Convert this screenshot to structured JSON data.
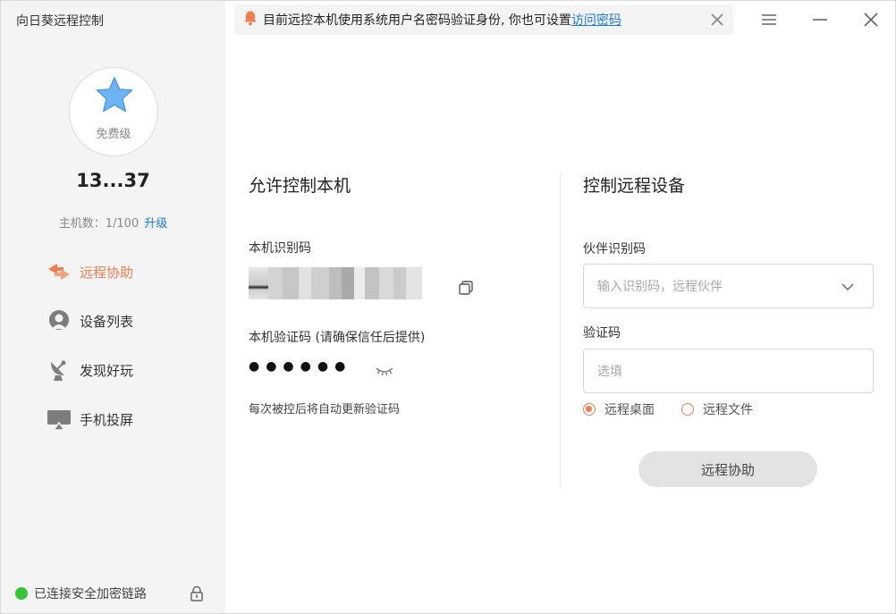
{
  "app": {
    "title": "向日葵远程控制"
  },
  "profile": {
    "tier": "免费级",
    "user_id": "13...37",
    "host_count": "主机数：1/100",
    "upgrade": "升级"
  },
  "nav": {
    "items": [
      {
        "label": "远程协助",
        "icon": "remote-assist-icon",
        "active": true
      },
      {
        "label": "设备列表",
        "icon": "device-list-icon",
        "active": false
      },
      {
        "label": "发现好玩",
        "icon": "satellite-icon",
        "active": false
      },
      {
        "label": "手机投屏",
        "icon": "screen-cast-icon",
        "active": false
      }
    ]
  },
  "status": {
    "secure_link": "已连接安全加密链路",
    "color": "#37c43a"
  },
  "notice": {
    "text": "目前远控本机使用系统用户名密码验证身份, 你也可设置",
    "link": "访问密码"
  },
  "allow_control": {
    "title": "允许控制本机",
    "id_label": "本机识别码",
    "verify_label": "本机验证码 (请确保信任后提供)",
    "password_masked": "●●●●●●",
    "hint": "每次被控后将自动更新验证码"
  },
  "control_remote": {
    "title": "控制远程设备",
    "partner_label": "伙伴识别码",
    "partner_placeholder": "输入识别码，远程伙伴",
    "code_label": "验证码",
    "code_placeholder": "选填",
    "options": [
      {
        "label": "远程桌面",
        "selected": true
      },
      {
        "label": "远程文件",
        "selected": false
      }
    ],
    "button": "远程协助"
  },
  "colors": {
    "accent": "#f07c52",
    "link": "#1f7ae0"
  }
}
